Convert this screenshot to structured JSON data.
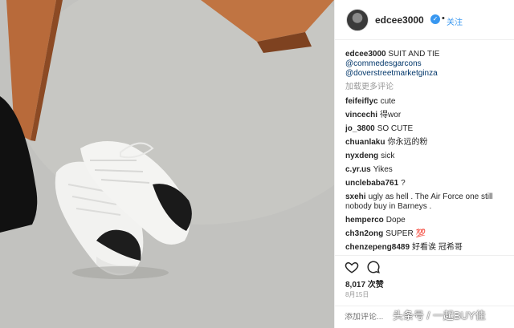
{
  "post": {
    "username": "edcee3000",
    "verified_glyph": "✓",
    "separator": "•",
    "follow_label": "关注",
    "caption_user": "edcee3000",
    "caption_text": " SUIT AND TIE",
    "mentions": [
      "@commedesgarcons",
      "@doverstreetmarketginza"
    ],
    "load_more": "加载更多评论",
    "comments": [
      {
        "user": "feifeiflyc",
        "text": "cute"
      },
      {
        "user": "vincechi",
        "text": "得wor"
      },
      {
        "user": "jo_3800",
        "text": "SO CUTE"
      },
      {
        "user": "chuanlaku",
        "text": "你永远的粉"
      },
      {
        "user": "nyxdeng",
        "text": "sick"
      },
      {
        "user": "c.yr.us",
        "text": "Yikes"
      },
      {
        "user": "unclebaba761",
        "text": "?"
      },
      {
        "user": "sxehi",
        "text": "ugly as hell . The Air Force one still nobody buy in Barneys ."
      },
      {
        "user": "hemperco",
        "text": "Dope"
      },
      {
        "user": "ch3n2ong",
        "text": "SUPER 💯"
      },
      {
        "user": "chenzepeng8489",
        "text": "好看诶 冠希哥"
      }
    ],
    "likes": "8,017 次赞",
    "date": "8月15日",
    "add_comment_placeholder": "添加评论..."
  },
  "watermark": "头条号 / 一起BUY佳",
  "icons": {
    "heart": "heart-icon",
    "comment": "comment-icon",
    "verified": "verified-badge-icon"
  }
}
